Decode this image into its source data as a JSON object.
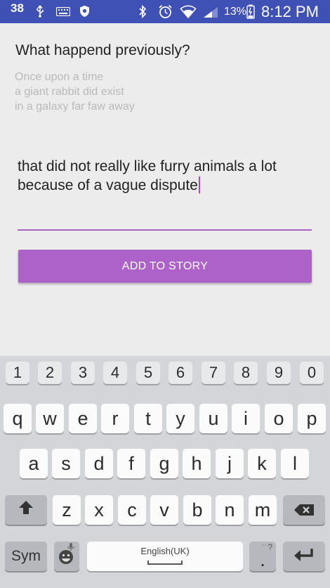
{
  "status_bar": {
    "notification_count": "38",
    "battery_percent": "13%",
    "time": "8:12 PM"
  },
  "story": {
    "question": "What happend previously?",
    "previous_lines": [
      "Once upon a time",
      "a giant rabbit did exist",
      "in a galaxy far faw away"
    ],
    "input_lines": [
      "that did not really like furry animals a lot",
      "because of a vague dispute"
    ],
    "add_button_label": "ADD TO STORY"
  },
  "keyboard": {
    "number_row": [
      "1",
      "2",
      "3",
      "4",
      "5",
      "6",
      "7",
      "8",
      "9",
      "0"
    ],
    "row1": [
      "q",
      "w",
      "e",
      "r",
      "t",
      "y",
      "u",
      "i",
      "o",
      "p"
    ],
    "row2": [
      "a",
      "s",
      "d",
      "f",
      "g",
      "h",
      "j",
      "k",
      "l"
    ],
    "row3": [
      "z",
      "x",
      "c",
      "v",
      "b",
      "n",
      "m"
    ],
    "sym_label": "Sym",
    "space_label": "English(UK)",
    "period_label": ".",
    "punct_hint": "?"
  },
  "colors": {
    "status_bar": "#3f51b5",
    "accent": "#ad62c9",
    "underline": "#a961c3"
  }
}
